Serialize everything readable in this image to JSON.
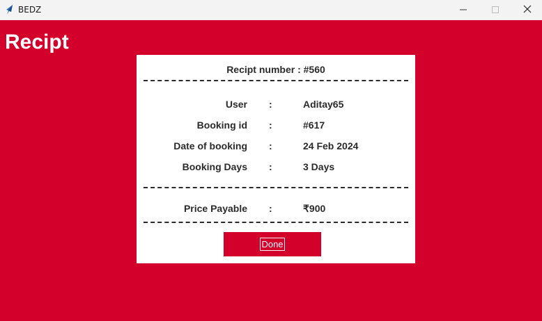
{
  "window": {
    "title": "BEDZ",
    "icons": {
      "app": "feather-icon",
      "minimize": "minimize-icon",
      "maximize": "maximize-icon",
      "close": "close-icon"
    }
  },
  "colors": {
    "background": "#d3002c",
    "card": "#ffffff",
    "text": "#2a2a2a",
    "titlebar": "#f3f3f3"
  },
  "page": {
    "title": "Recipt"
  },
  "receipt": {
    "header": "Recipt number :  #560",
    "rows": [
      {
        "label": "User",
        "sep": ":",
        "value": "Aditay65"
      },
      {
        "label": "Booking id",
        "sep": ":",
        "value": "#617"
      },
      {
        "label": "Date of booking",
        "sep": ":",
        "value": "24 Feb 2024"
      },
      {
        "label": "Booking Days",
        "sep": ":",
        "value": "3 Days"
      }
    ],
    "total": {
      "label": "Price Payable",
      "sep": ":",
      "value": "₹900"
    }
  },
  "actions": {
    "done_label": "Done"
  }
}
